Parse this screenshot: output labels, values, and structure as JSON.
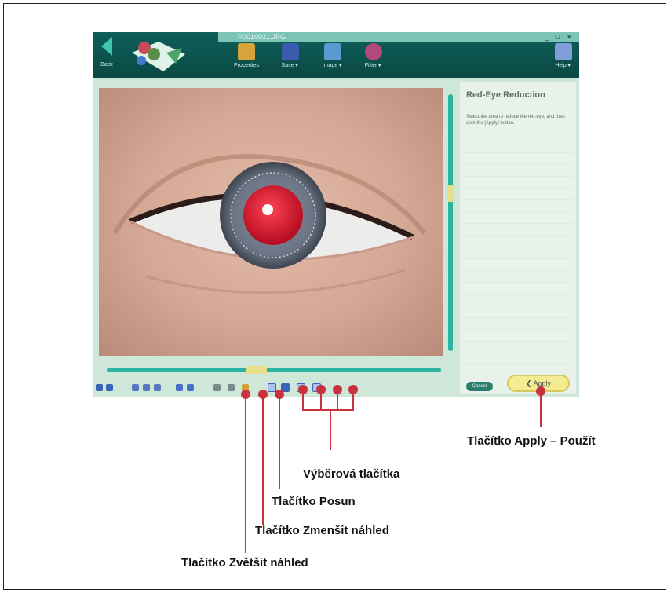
{
  "window": {
    "filename": "P0010021.JPG",
    "controls": "_ □ ✕",
    "back_label": "Back",
    "help_label": "Help▼"
  },
  "toolbar": {
    "items": [
      {
        "label": "Properties",
        "icon": "properties-icon",
        "color": "#d6a43a"
      },
      {
        "label": "Save▼",
        "icon": "save-icon",
        "color": "#3b5cae"
      },
      {
        "label": "Image▼",
        "icon": "image-icon",
        "color": "#5a9ad1"
      },
      {
        "label": "Filter▼",
        "icon": "filter-icon",
        "color": "#b04a7a"
      }
    ]
  },
  "panel": {
    "title": "Red-Eye Reduction",
    "description": "Select the area to reduce the red-eye, and then click the [Apply] button.",
    "cancel_label": "Cancel",
    "apply_label": "Apply"
  },
  "callouts": {
    "apply": "Tlačítko Apply – Použít",
    "selection": "Výběrová tlačítka",
    "pan": "Tlačítko Posun",
    "zoom_out": "Tlačítko Zmenšit náhled",
    "zoom_in": "Tlačítko Zvětšit náhled"
  },
  "colors": {
    "toolbar_bg": "#0f5f5a",
    "accent": "#2db4a0",
    "callout": "#c8323c",
    "apply_button": "#f4ec93"
  }
}
